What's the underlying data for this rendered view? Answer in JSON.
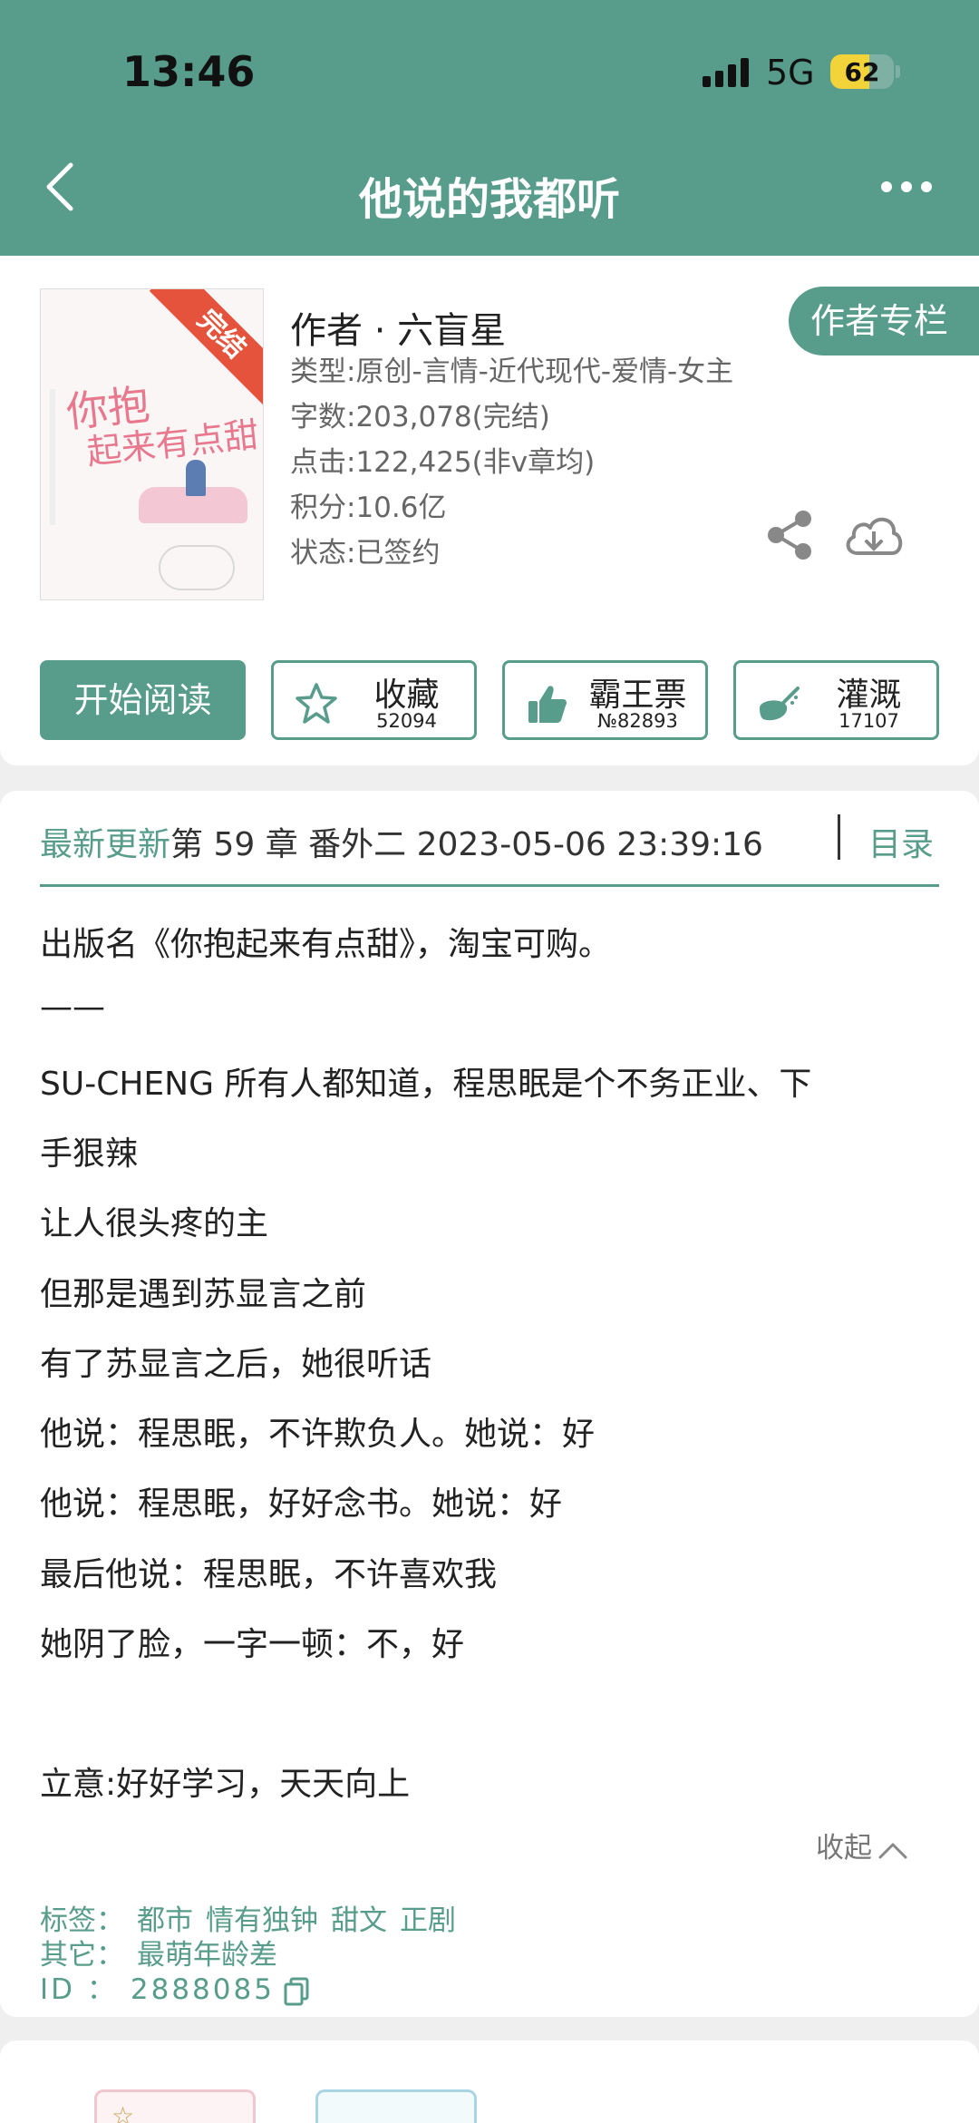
{
  "status_bar": {
    "time": "13:46",
    "network": "5G",
    "battery": "62",
    "battery_level": 0.62
  },
  "header": {
    "title": "他说的我都听"
  },
  "book": {
    "cover": {
      "badge": "完结",
      "title_line1": "你抱",
      "title_line2": "起来有点甜"
    },
    "author": "作者 · 六盲星",
    "author_column_button": "作者专栏",
    "meta": [
      "类型:原创-言情-近代现代-爱情-女主",
      "字数:203,078(完结)",
      "点击:122,425(非v章均)",
      "积分:10.6亿",
      "状态:已签约"
    ]
  },
  "actions": {
    "read": "开始阅读",
    "collect": {
      "label": "收藏",
      "count": "52094"
    },
    "vote": {
      "label": "霸王票",
      "count": "№82893"
    },
    "water": {
      "label": "灌溉",
      "count": "17107"
    }
  },
  "update": {
    "label": "最新更新",
    "text": "第 59 章  番外二 2023-05-06 23:39:16",
    "toc": "目录"
  },
  "description": [
    "出版名《你抱起来有点甜》，淘宝可购。",
    "——",
    " SU-CHENG 所有人都知道，程思眠是个不务正业、下",
    "手狠辣",
    "让人很头疼的主",
    "但那是遇到苏显言之前",
    "有了苏显言之后，她很听话",
    "他说：程思眠，不许欺负人。她说：好",
    "他说：程思眠，好好念书。她说：好",
    "最后他说：程思眠，不许喜欢我",
    "她阴了脸，一字一顿：不，好",
    "",
    "立意:好好学习，天天向上"
  ],
  "collapse": "收起",
  "tags": {
    "label": "标签：",
    "items": [
      "都市",
      "情有独钟",
      "甜文",
      "正剧"
    ],
    "other_label": "其它：",
    "other_value": "最萌年龄差",
    "id_label": "ID ：",
    "id_value": "2888085"
  },
  "colors": {
    "brand": "#589c8b",
    "ribbon": "#e5533c",
    "battery": "#f2d33a"
  }
}
